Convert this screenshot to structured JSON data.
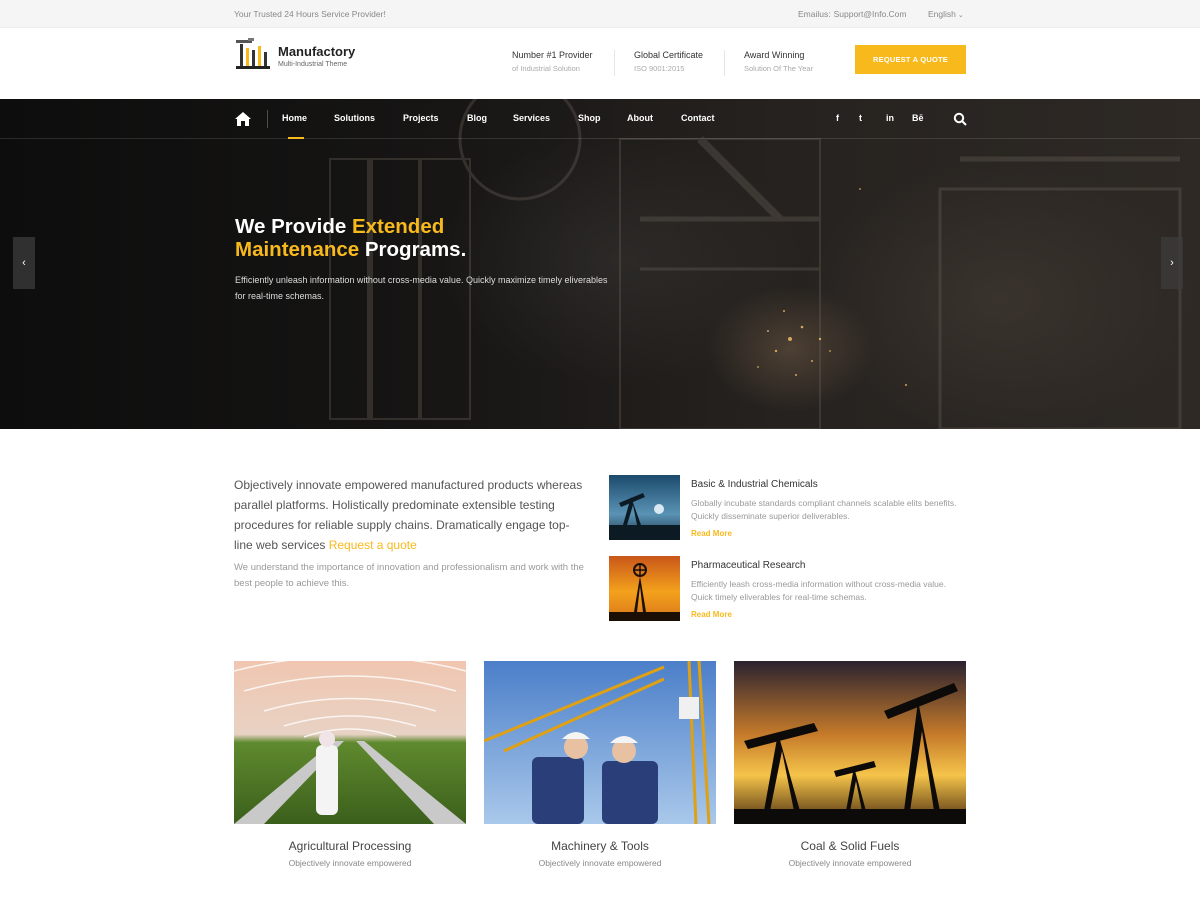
{
  "topbar": {
    "tagline": "Your Trusted 24 Hours Service Provider!",
    "email_label": "Emailus:",
    "email": "Support@Info.Com",
    "language": "English"
  },
  "header": {
    "logo_name": "Manufactory",
    "logo_sub": "Multi-Industrial Theme",
    "info": [
      {
        "title": "Number #1 Provider",
        "sub": "of Industrial Solution"
      },
      {
        "title": "Global Certificate",
        "sub": "ISO 9001:2015"
      },
      {
        "title": "Award Winning",
        "sub": "Solution Of The Year"
      }
    ],
    "quote_button": "REQUEST A QUOTE"
  },
  "nav": {
    "items": [
      "Home",
      "Solutions",
      "Projects",
      "Blog",
      "Services",
      "Shop",
      "About",
      "Contact"
    ],
    "active": "Home",
    "social": [
      "f",
      "t",
      "in",
      "Bē"
    ]
  },
  "hero": {
    "h1_part1": "We Provide ",
    "h1_part2": "Extended",
    "h1_part3": "Maintenance",
    "h1_part4": " Programs.",
    "lead": "Efficiently unleash information without cross-media value. Quickly maximize timely eliverables for real-time schemas.",
    "prev": "‹",
    "next": "›"
  },
  "intro": {
    "text": "Objectively innovate empowered manufactured products whereas parallel platforms. Holistically predominate extensible testing procedures for reliable supply chains. Dramatically engage top-line web services ",
    "link": "Request a quote",
    "secondary": "We understand the importance of innovation and professionalism and work with the best people to achieve this."
  },
  "services": [
    {
      "title": "Basic & Industrial Chemicals",
      "desc": "Globally incubate standards compliant channels scalable elits benefits. Quickly disseminate superior deliverables.",
      "more": "Read More"
    },
    {
      "title": "Pharmaceutical Research",
      "desc": "Efficiently leash cross-media information without cross-media value. Quick timely eliverables for real-time schemas.",
      "more": "Read More"
    }
  ],
  "cards": [
    {
      "title": "Agricultural Processing",
      "sub": "Objectively innovate empowered"
    },
    {
      "title": "Machinery & Tools",
      "sub": "Objectively innovate empowered"
    },
    {
      "title": "Coal & Solid Fuels",
      "sub": "Objectively innovate empowered"
    }
  ],
  "colors": {
    "accent": "#f8b91c",
    "hero_dark": "#161514",
    "topbar_bg": "#f5f5f5"
  },
  "icons": [
    "factory-logo-icon",
    "home-icon",
    "facebook-icon",
    "twitter-icon",
    "linkedin-icon",
    "behance-icon",
    "search-icon",
    "chevron-left-icon",
    "chevron-right-icon"
  ]
}
